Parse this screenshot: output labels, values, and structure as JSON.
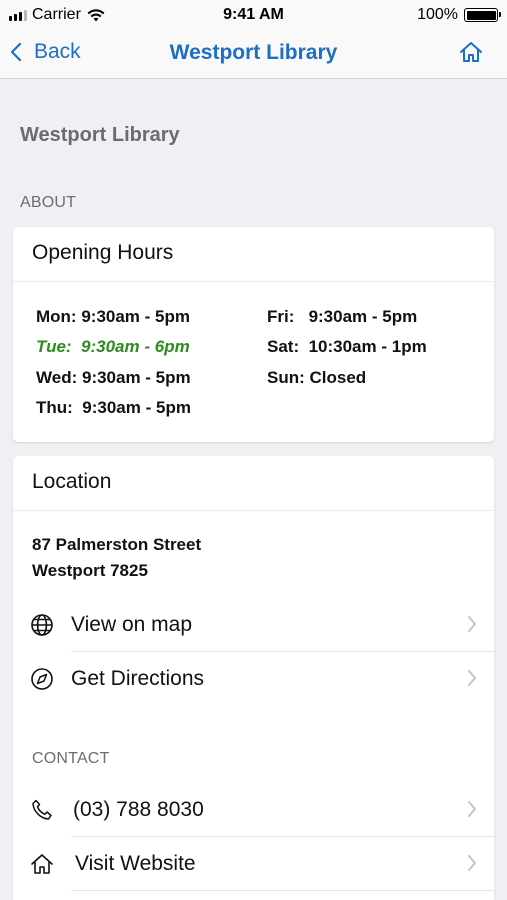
{
  "status_bar": {
    "carrier": "Carrier",
    "time": "9:41 AM",
    "battery": "100%",
    "battery_level": 1.0
  },
  "nav": {
    "back_label": "Back",
    "title": "Westport Library",
    "home_icon": "home-icon"
  },
  "page": {
    "heading": "Westport Library",
    "about_label": "ABOUT"
  },
  "hours": {
    "title": "Opening Hours",
    "left": [
      {
        "day": "Mon:",
        "time": "9:30am - 5pm",
        "today": false
      },
      {
        "day": "Tue:",
        "time": "9:30am - 6pm",
        "today": true
      },
      {
        "day": "Wed:",
        "time": "9:30am - 5pm",
        "today": false
      },
      {
        "day": "Thu:",
        "time": "9:30am - 5pm",
        "today": false
      }
    ],
    "right": [
      {
        "day": "Fri:",
        "time": "9:30am - 5pm",
        "today": false
      },
      {
        "day": "Sat:",
        "time": "10:30am - 1pm",
        "today": false
      },
      {
        "day": "Sun:",
        "time": "Closed",
        "today": false
      }
    ],
    "today_color": "#2e8b1f"
  },
  "location": {
    "title": "Location",
    "address_line1": "87 Palmerston Street",
    "address_line2": "Westport 7825",
    "view_map_label": "View on map",
    "directions_label": "Get Directions"
  },
  "contact": {
    "section_label": "CONTACT",
    "phone": "(03) 788 8030",
    "website_label": "Visit Website"
  },
  "colors": {
    "accent": "#1c6fc4",
    "background": "#efeff4"
  }
}
